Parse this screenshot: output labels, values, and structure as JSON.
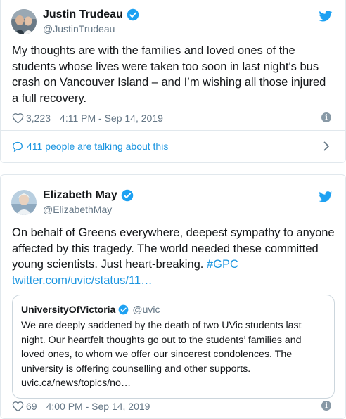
{
  "tweet1": {
    "author_name": "Justin Trudeau",
    "handle": "@JustinTrudeau",
    "text": "My thoughts are with the families and loved ones of the students whose lives were taken too soon in last night's bus crash on Vancouver Island – and I’m wishing all those injured a full recovery.",
    "likes": "3,223",
    "timestamp": "4:11 PM - Sep 14, 2019",
    "talking": "411 people are talking about this"
  },
  "tweet2": {
    "author_name": "Elizabeth May",
    "handle": "@ElizabethMay",
    "text": "On behalf of Greens everywhere, deepest sympathy to anyone affected by this tragedy. The world needed these committed young scientists. Just heart-breaking.",
    "hashtag": "#GPC",
    "link": "twitter.com/uvic/status/11…",
    "likes": "69",
    "timestamp": "4:00 PM - Sep 14, 2019",
    "quote": {
      "author_name": "UniversityOfVictoria",
      "handle": "@uvic",
      "text": "We are deeply saddened by the death of two UVic students last night. Our heartfelt thoughts go out to the students’ families and loved ones, to whom we offer our sincerest condolences. The university is offering counselling and other supports. uvic.ca/news/topics/no…"
    }
  },
  "icons": {
    "verified": "verified-badge-icon",
    "bird": "twitter-bird-icon",
    "heart": "heart-icon",
    "info": "info-icon",
    "bubble": "speech-bubble-icon",
    "chevron": "chevron-right-icon"
  },
  "colors": {
    "twitter_blue": "#1da1f2",
    "link_blue": "#1b95e0",
    "secondary_text": "#657786",
    "border": "#e1e8ed"
  }
}
